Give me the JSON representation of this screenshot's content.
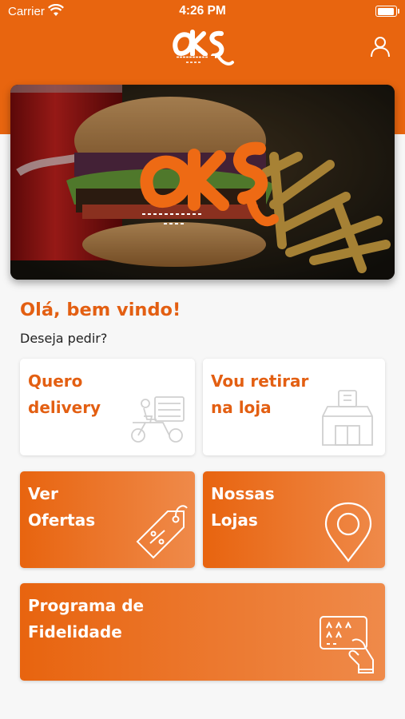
{
  "status_bar": {
    "carrier": "Carrier",
    "time": "4:26 PM"
  },
  "icons": {
    "profile": "user-icon",
    "delivery": "scooter-icon",
    "pickup": "store-icon",
    "offers": "price-tag-icon",
    "stores": "location-pin-icon",
    "loyalty": "card-hand-icon"
  },
  "colors": {
    "brand": "#e8650f",
    "title": "#e35f12"
  },
  "greeting": {
    "title": "Olá, bem vindo!",
    "subtitle": "Deseja pedir?"
  },
  "cards": {
    "delivery": [
      "Quero",
      "delivery"
    ],
    "pickup": [
      "Vou retirar",
      "na loja"
    ],
    "offers": [
      "Ver",
      "Ofertas"
    ],
    "stores": [
      "Nossas",
      "Lojas"
    ],
    "loyalty": [
      "Programa de",
      "Fidelidade"
    ]
  }
}
